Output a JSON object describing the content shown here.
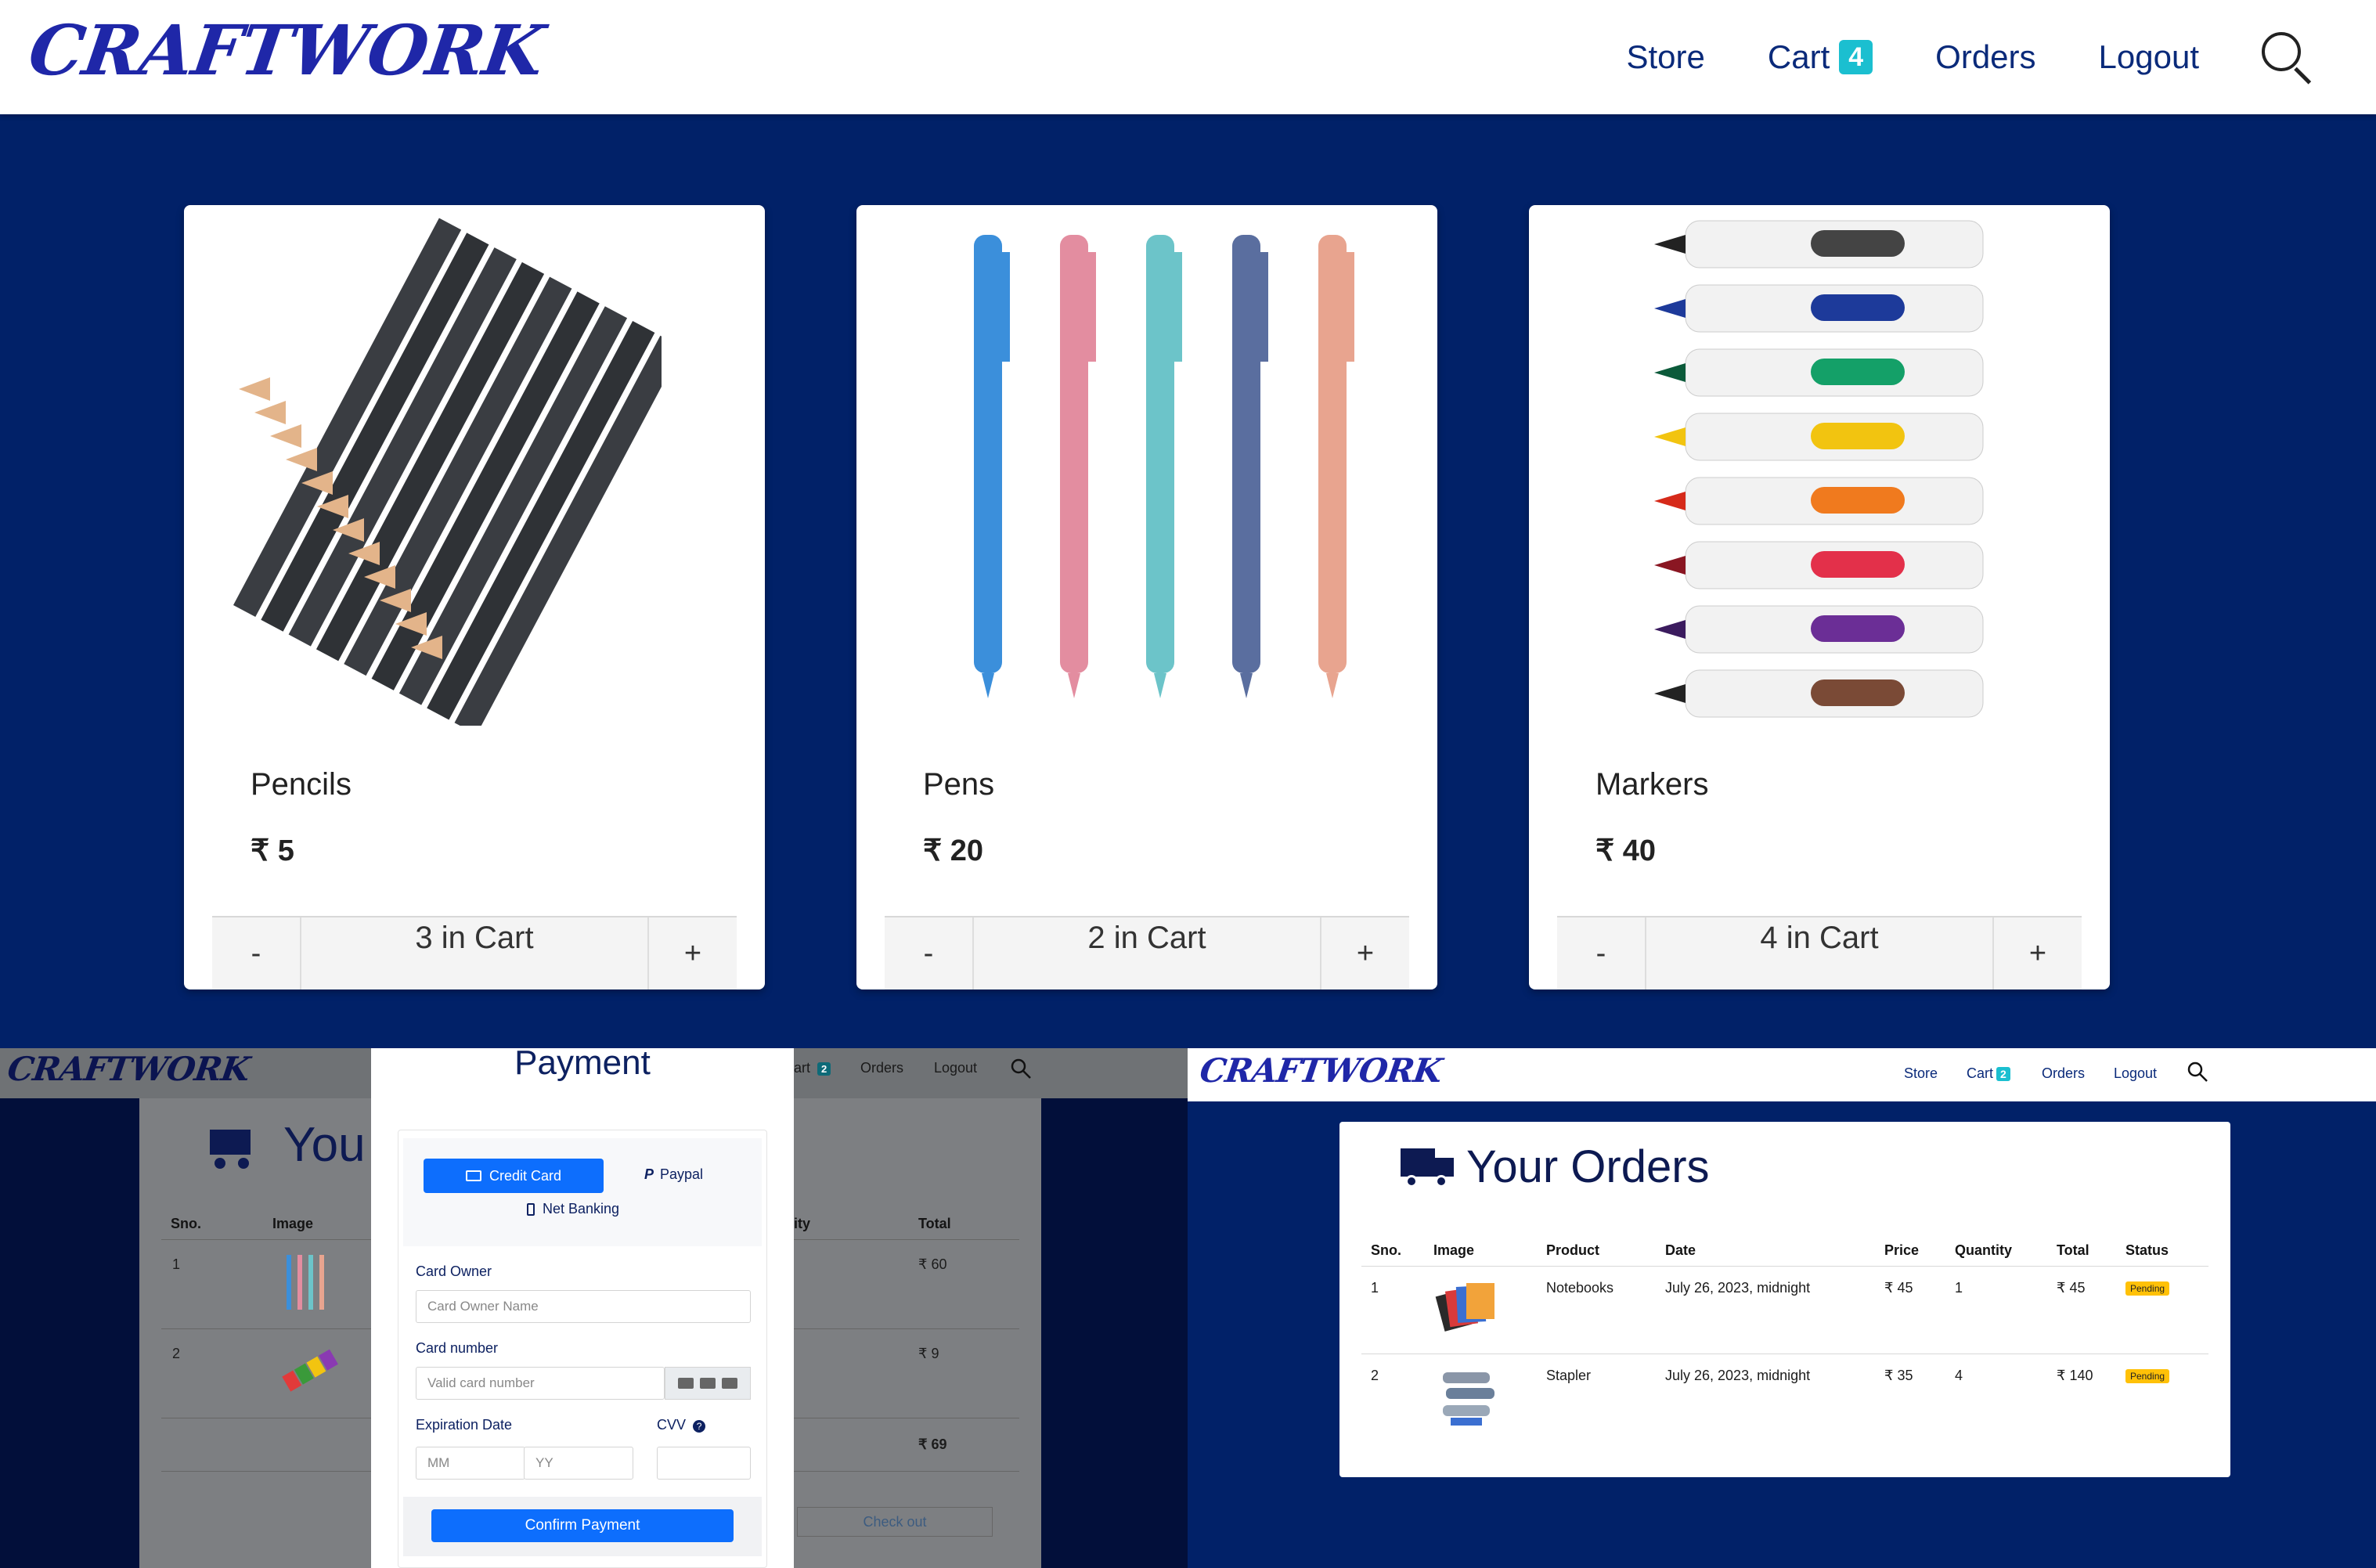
{
  "nav": {
    "logo": "CRAFTWORK",
    "store": "Store",
    "cart": "Cart",
    "cart_count": "4",
    "orders": "Orders",
    "logout": "Logout"
  },
  "products": [
    {
      "name": "Pencils",
      "price": "₹ 5",
      "in_cart": "3 in Cart",
      "minus": "-",
      "plus": "+"
    },
    {
      "name": "Pens",
      "price": "₹ 20",
      "in_cart": "2 in Cart",
      "minus": "-",
      "plus": "+"
    },
    {
      "name": "Markers",
      "price": "₹ 40",
      "in_cart": "4 in Cart",
      "minus": "-",
      "plus": "+"
    }
  ],
  "cart_view": {
    "logo": "CRAFTWORK",
    "nav_cart": "art",
    "nav_cart_count": "2",
    "nav_orders": "Orders",
    "nav_logout": "Logout",
    "title": "You",
    "headers": {
      "sno": "Sno.",
      "image": "Image",
      "quantity": "ity",
      "total": "Total"
    },
    "rows": [
      {
        "sno": "1",
        "total": "₹ 60"
      },
      {
        "sno": "2",
        "total": "₹ 9"
      }
    ],
    "grand_total": "₹ 69",
    "checkout": "Check out"
  },
  "payment": {
    "title": "Payment",
    "tab_credit": "Credit Card",
    "tab_paypal": "Paypal",
    "tab_netbanking": "Net Banking",
    "card_owner_label": "Card Owner",
    "card_owner_placeholder": "Card Owner Name",
    "card_number_label": "Card number",
    "card_number_placeholder": "Valid card number",
    "expiration_label": "Expiration Date",
    "cvv_label": "CVV",
    "mm_placeholder": "MM",
    "yy_placeholder": "YY",
    "confirm": "Confirm Payment"
  },
  "orders_view": {
    "logo": "CRAFTWORK",
    "nav_store": "Store",
    "nav_cart": "Cart",
    "nav_cart_count": "2",
    "nav_orders": "Orders",
    "nav_logout": "Logout",
    "title": "Your Orders",
    "headers": {
      "sno": "Sno.",
      "image": "Image",
      "product": "Product",
      "date": "Date",
      "price": "Price",
      "quantity": "Quantity",
      "total": "Total",
      "status": "Status"
    },
    "rows": [
      {
        "sno": "1",
        "product": "Notebooks",
        "date": "July 26, 2023, midnight",
        "price": "₹ 45",
        "quantity": "1",
        "total": "₹ 45",
        "status": "Pending"
      },
      {
        "sno": "2",
        "product": "Stapler",
        "date": "July 26, 2023, midnight",
        "price": "₹ 35",
        "quantity": "4",
        "total": "₹ 140",
        "status": "Pending"
      }
    ]
  }
}
